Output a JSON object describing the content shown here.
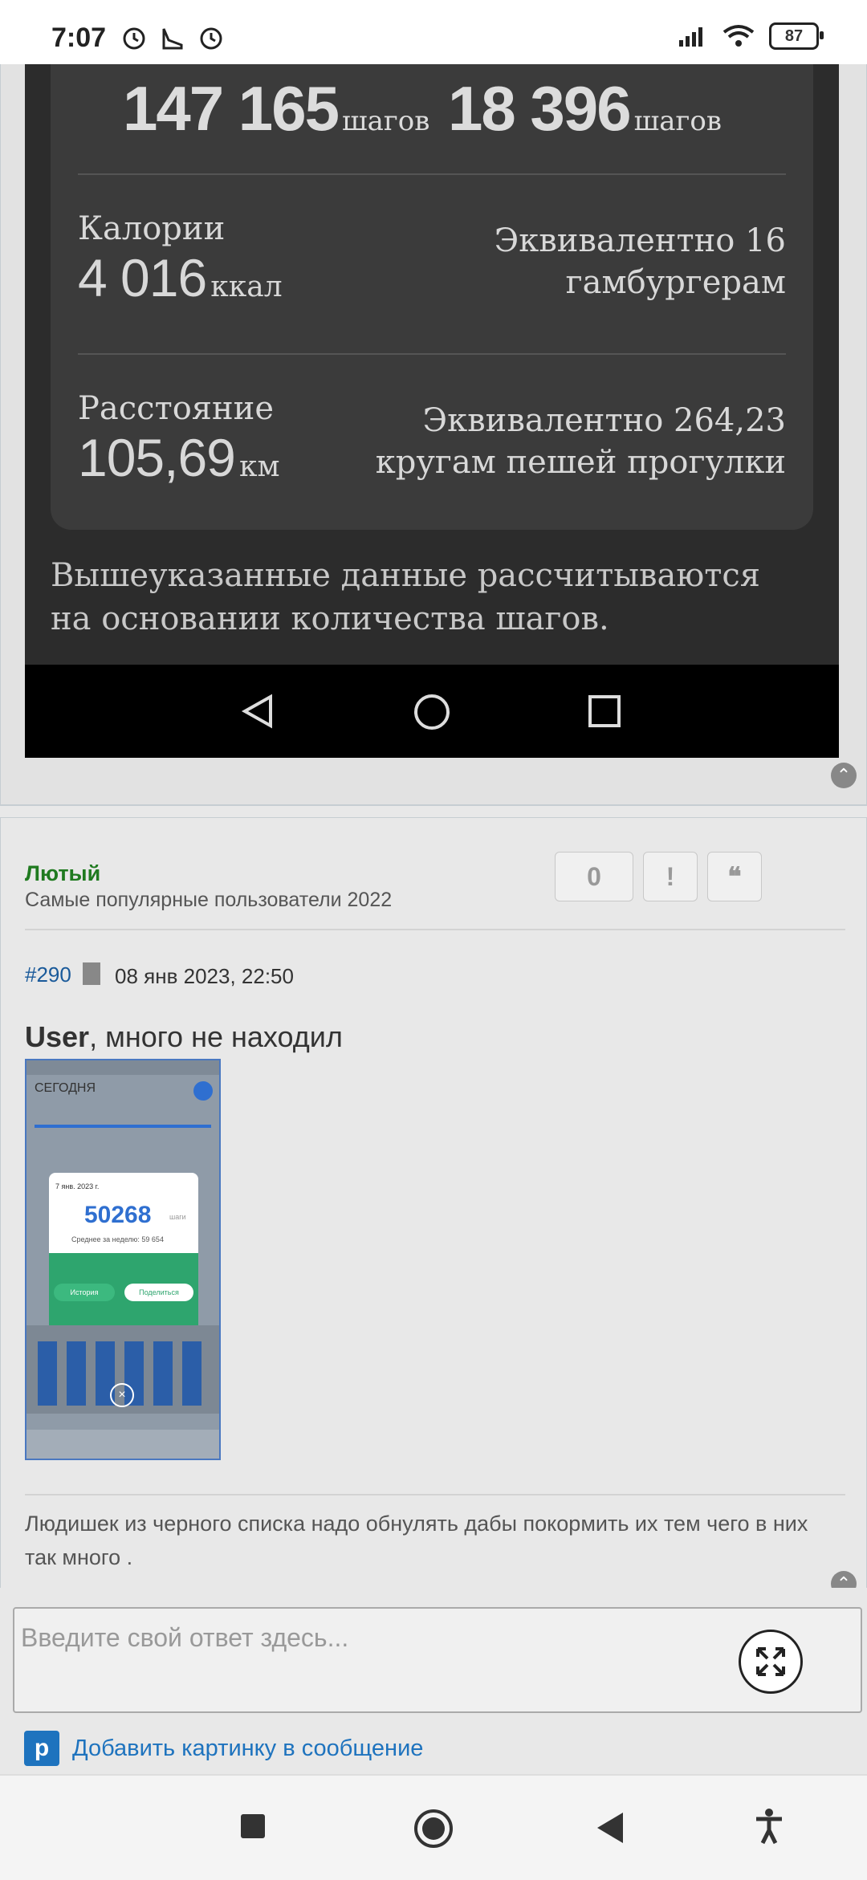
{
  "status_bar": {
    "time": "7:07",
    "battery": "87",
    "icons": [
      "alarm-icon",
      "sneaker-icon",
      "alarm-icon",
      "signal-icon",
      "wifi-icon",
      "battery-icon"
    ]
  },
  "embedded_screenshot": {
    "steps_left_value": "147 165",
    "steps_left_unit": "шагов",
    "steps_right_value": "18 396",
    "steps_right_unit": "шагов",
    "calories_label": "Калории",
    "calories_value": "4 016",
    "calories_unit": "ккал",
    "calories_equivalent": "Эквивалентно 16 гамбургерам",
    "distance_label": "Расстояние",
    "distance_value": "105,69",
    "distance_unit": "км",
    "distance_equivalent": "Эквивалентно 264,23 кругам пешей прогулки",
    "note": "Вышеуказанные данные рассчитываются на основании количества шагов."
  },
  "post": {
    "author": "Лютый",
    "rank": "Самые популярные пользователи 2022",
    "like_count": "0",
    "report_label": "!",
    "quote_label": "❝",
    "number": "#290",
    "date": "08 янв 2023, 22:50",
    "mention": "User",
    "text": ", много не находил",
    "signature": "Людишек из черного списка надо обнулять дабы покормить их тем чего в них так много ."
  },
  "thumbnail": {
    "header": "СЕГОДНЯ",
    "popup_date": "7 янв. 2023 г.",
    "popup_value": "50268",
    "popup_unit": "шаги",
    "popup_avg": "Среднее за неделю: 59 654",
    "history_btn": "История",
    "share_btn": "Поделиться"
  },
  "reply": {
    "placeholder": "Введите свой ответ здесь...",
    "add_image_label": "Добавить картинку в сообщение"
  },
  "colors": {
    "author": "#1f7a1f",
    "link": "#1e73be",
    "post_number": "#1a5a9a"
  }
}
